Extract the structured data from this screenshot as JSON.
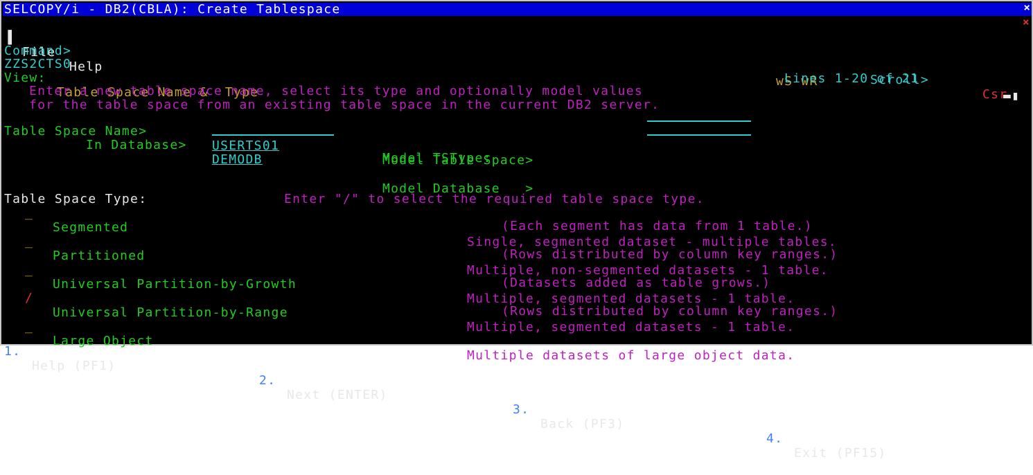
{
  "title": "SELCOPY/i - DB2(CBLA): Create Tablespace",
  "menu": {
    "file": "File",
    "help": "Help"
  },
  "status_right": "wS wR",
  "command": {
    "label": "Command>",
    "value": ""
  },
  "scroll": {
    "label": "Scroll>",
    "value": "Csr"
  },
  "panel_id": "ZZS2CTS0",
  "lines_info": "Lines 1-20 of 21",
  "view": {
    "label": "View:",
    "name": "Table Space Name &  Type"
  },
  "instructions": [
    "Enter a new table space name, select its type and optionally model values",
    "for the table space from an existing table space in the current DB2 server."
  ],
  "fields": {
    "ts_name_label": "Table Space Name>",
    "ts_name_value": "USERTS01",
    "db_label": "In Database>",
    "db_value": "DEMODB",
    "model_ts_label": "Model Table Space>",
    "model_ts_value": "",
    "model_db_label": "Model Database   >",
    "model_db_value": "",
    "model_type_label": "Model TSType:"
  },
  "type_header": {
    "label": "Table Space Type:",
    "hint": "Enter \"/\" to select the required table space type."
  },
  "types": [
    {
      "sel": "_",
      "name": "Segmented",
      "desc1": "Single, segmented dataset - multiple tables.",
      "desc2": "(Each segment has data from 1 table.)"
    },
    {
      "sel": "_",
      "name": "Partitioned",
      "desc1": "Multiple, non-segmented datasets - 1 table.",
      "desc2": "(Rows distributed by column key ranges.)"
    },
    {
      "sel": "_",
      "name": "Universal Partition-by-Growth",
      "desc1": "Multiple, segmented datasets - 1 table.",
      "desc2": "(Datasets added as table grows.)"
    },
    {
      "sel": "/",
      "name": "Universal Partition-by-Range",
      "desc1": "Multiple, segmented datasets - 1 table.",
      "desc2": "(Rows distributed by column key ranges.)"
    },
    {
      "sel": "_",
      "name": "Large Object",
      "desc1": "Multiple datasets of large object data.",
      "desc2": ""
    }
  ],
  "pf_keys": [
    {
      "num": "1.",
      "label": "Help (PF1)"
    },
    {
      "num": "2.",
      "label": "Next (ENTER)"
    },
    {
      "num": "3.",
      "label": "Back (PF3)"
    },
    {
      "num": "4.",
      "label": "Exit (PF15)"
    }
  ]
}
